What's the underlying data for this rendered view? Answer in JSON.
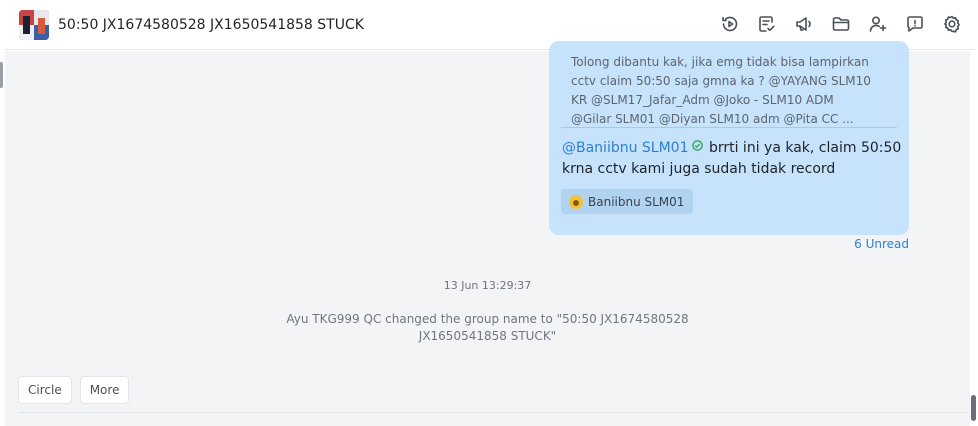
{
  "header": {
    "title": "50:50 JX1674580528 JX1650541858 STUCK",
    "toolbar_icons": [
      "history-icon",
      "task-edit-icon",
      "announcement-icon",
      "folder-icon",
      "add-member-icon",
      "chat-bubble-icon",
      "settings-icon"
    ]
  },
  "message": {
    "quote_lines": [
      "Tolong dibantu kak, jika emg tidak bisa lampirkan",
      "cctv claim 50:50 saja gmna ka ? @YAYANG SLM10",
      "KR @SLM17_Jafar_Adm @Joko - SLM10 ADM",
      "@Gilar SLM01 @Diyan SLM10 adm @Pita CC ..."
    ],
    "mention": "@Baniibnu SLM01",
    "text": "brrti ini ya kak, claim 50:50 krna cctv kami juga sudah tidak record",
    "reaction_user": "Baniibnu SLM01",
    "accent_color": "#2d7fd6",
    "bubble_color": "#c6e3fb"
  },
  "unread_label": "6 Unread",
  "timestamp": "13 Jun 13:29:37",
  "system_message": {
    "line1": "Ayu TKG999 QC changed the group name to \"50:50 JX1674580528",
    "line2": "JX1650541858 STUCK\""
  },
  "quick_actions": [
    "Circle",
    "More"
  ]
}
